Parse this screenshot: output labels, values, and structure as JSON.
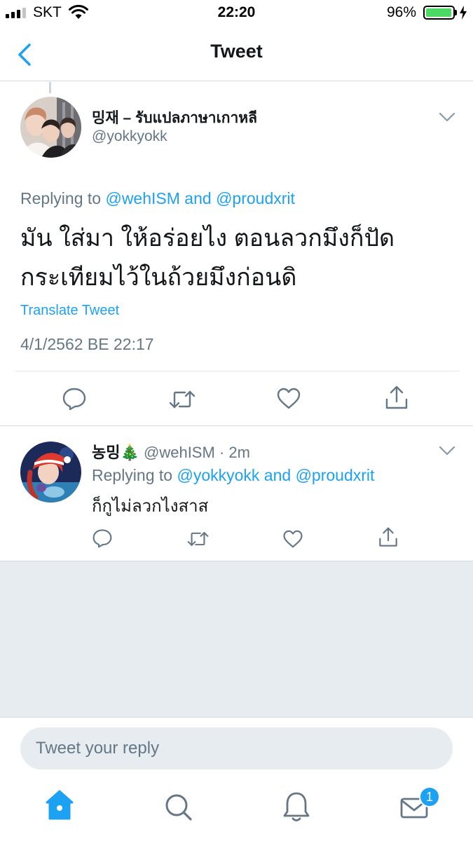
{
  "status_bar": {
    "carrier": "SKT",
    "time": "22:20",
    "battery_percent": "96%",
    "battery_level": 0.96,
    "signal_bars_filled": 3,
    "signal_bars_total": 4
  },
  "nav": {
    "back_icon": "chevron-left-icon",
    "title": "Tweet"
  },
  "main_tweet": {
    "display_name": "밍재 – รับแปลภาษาเกาหลี",
    "handle": "@yokkyokk",
    "replying_prefix": "Replying to",
    "mention_1": "@wehISM",
    "and": "and",
    "mention_2": "@proudxrit",
    "text_lines": [
      "มัน ใส่มา ให้อร่อยไง ตอนลวกมึงก็ปัด",
      "กระเทียมไว้ในถ้วยมึงก่อนดิ"
    ],
    "translate_label": "Translate Tweet",
    "timestamp": "4/1/2562 BE 22:17"
  },
  "reply_tweet": {
    "display_name": "농밍🎄",
    "meta": "@wehISM · 2m",
    "replying_prefix": "Replying to",
    "mention_1": "@yokkyokk",
    "and": "and",
    "mention_2": "@proudxrit",
    "text": "ก็กูไม่ลวกไงสาส"
  },
  "composer": {
    "placeholder": "Tweet your reply"
  },
  "tab_bar": {
    "tabs": [
      "home-icon",
      "search-icon",
      "notifications-icon",
      "messages-icon"
    ],
    "messages_badge": "1"
  },
  "colors": {
    "accent": "#1da1f2",
    "secondary_text": "#657786",
    "primary_text": "#14171a",
    "background_gray": "#e6ecf0",
    "battery_green": "#4cd964"
  }
}
